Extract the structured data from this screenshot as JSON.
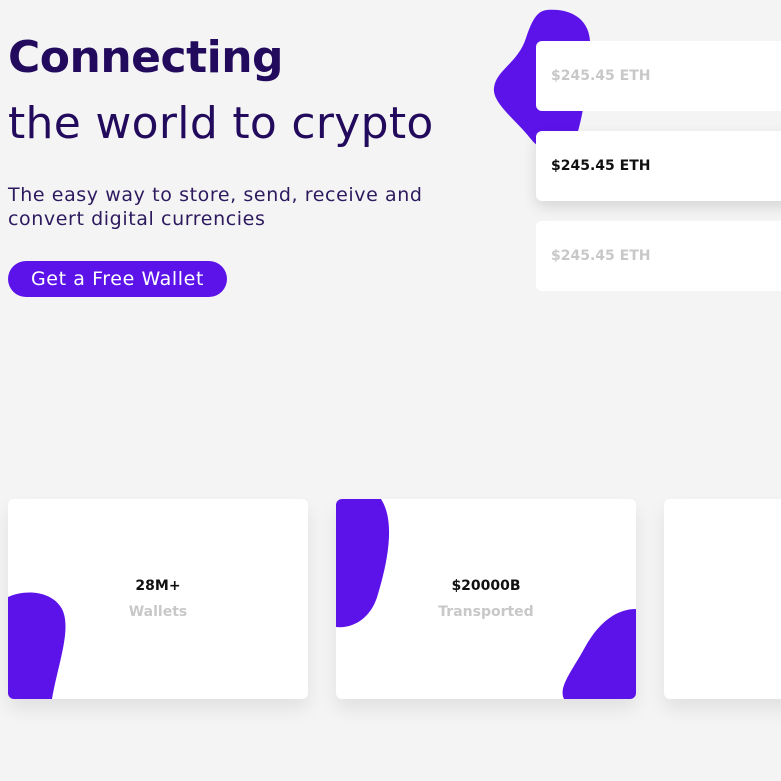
{
  "hero": {
    "title": "Connecting",
    "subtitle": "the world to crypto",
    "description": "The easy way to store, send, receive and convert digital currencies",
    "cta_label": "Get a Free Wallet"
  },
  "cards": [
    {
      "value": "$245.45 ETH",
      "state": "faded"
    },
    {
      "value": "$245.45 ETH",
      "state": "active"
    },
    {
      "value": "$245.45 ETH",
      "state": "faded"
    }
  ],
  "stats": [
    {
      "value": "28M+",
      "label": "Wallets"
    },
    {
      "value": "$20000B",
      "label": "Transported"
    },
    {
      "value": "",
      "label": ""
    }
  ],
  "colors": {
    "accent": "#5c13ea",
    "heading": "#220a5c",
    "background": "#f4f4f4",
    "muted": "#c8c8c8"
  }
}
